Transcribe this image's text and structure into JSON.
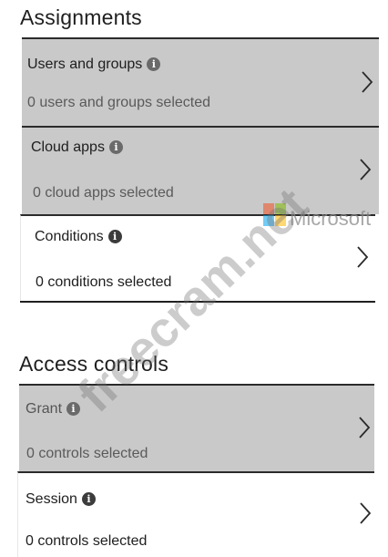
{
  "assignments": {
    "title": "Assignments",
    "items": [
      {
        "label": "Users and groups",
        "sub": "0 users and groups selected"
      },
      {
        "label": "Cloud apps",
        "sub": "0 cloud apps selected"
      },
      {
        "label": "Conditions",
        "sub": "0 conditions selected"
      }
    ]
  },
  "access_controls": {
    "title": "Access controls",
    "items": [
      {
        "label": "Grant",
        "sub": "0 controls selected"
      },
      {
        "label": "Session",
        "sub": "0 controls selected"
      }
    ]
  },
  "watermark": {
    "text": "freecram.net",
    "brand": "Microsoft"
  },
  "icons": {
    "info": "info-icon",
    "chevron": "chevron-right-icon"
  },
  "colors": {
    "selected_bg": "#c9c9c9",
    "border": "#2b2b2b"
  }
}
